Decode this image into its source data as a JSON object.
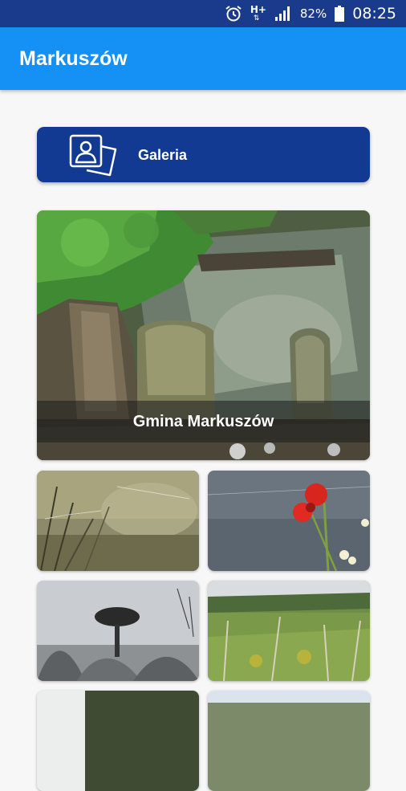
{
  "status_bar": {
    "network": "H+",
    "battery": "82%",
    "time": "08:25"
  },
  "app_bar": {
    "title": "Markuszów"
  },
  "gallery_button": {
    "label": "Galeria"
  },
  "hero": {
    "caption": "Gmina Markuszów"
  },
  "colors": {
    "status_bar": "#1a3a8c",
    "app_bar": "#1590f5",
    "button": "#123a93",
    "background": "#f7f7f7"
  }
}
